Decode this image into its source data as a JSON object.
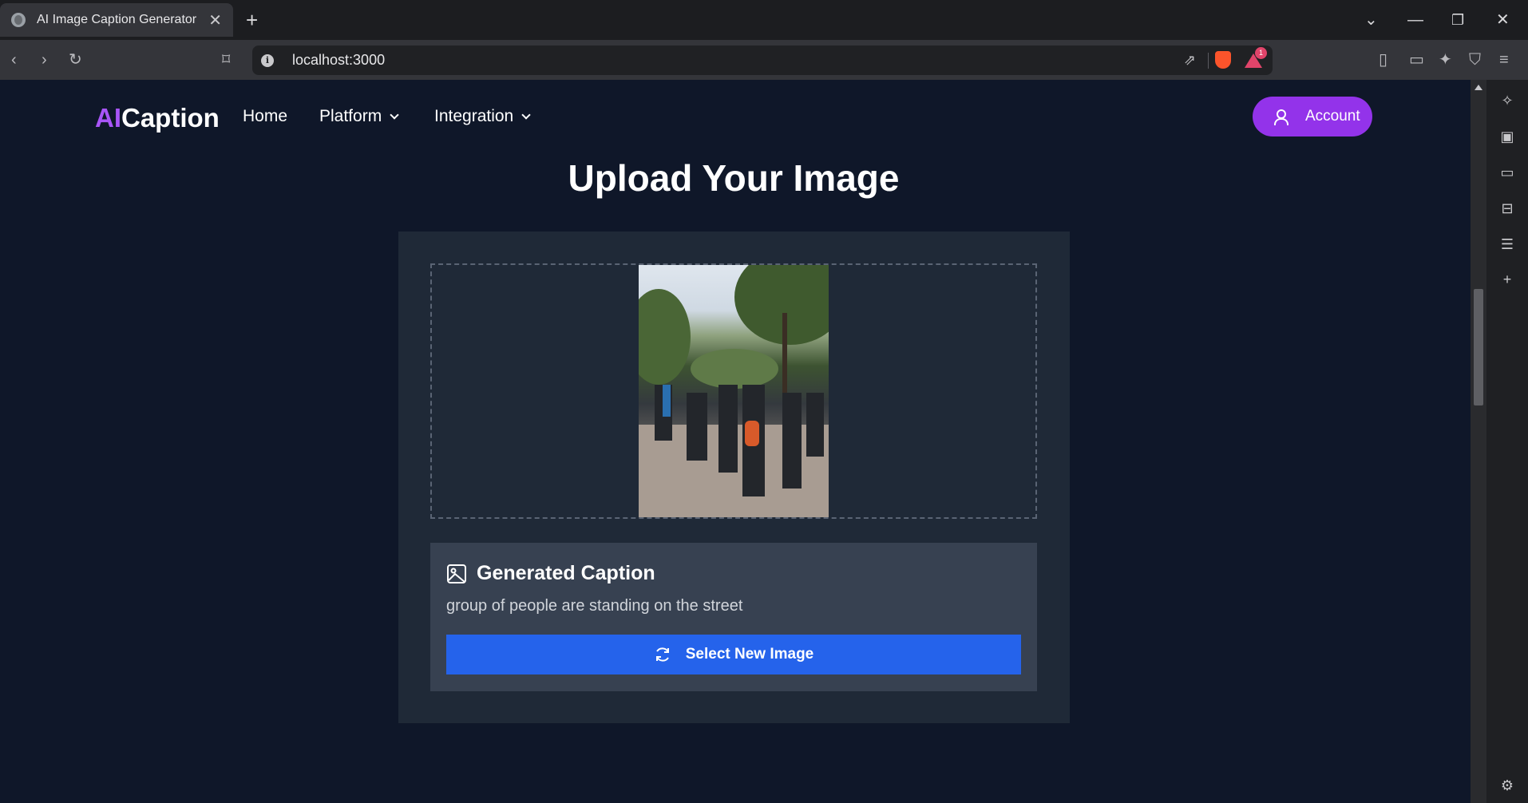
{
  "browser": {
    "tab_title": "AI Image Caption Generator",
    "tab_close": "✕",
    "new_tab": "+",
    "url": "localhost:3000",
    "info_icon": "i",
    "notification_count": "1",
    "window_controls": {
      "dropdown": "⌄",
      "minimize": "—",
      "restore": "❐",
      "close": "✕"
    }
  },
  "site": {
    "logo_prefix": "AI",
    "logo_suffix": "Caption",
    "nav": {
      "home": "Home",
      "platform": "Platform",
      "integration": "Integration"
    },
    "account_label": "Account",
    "accent_color": "#9333ea"
  },
  "main": {
    "title": "Upload Your Image",
    "caption_heading": "Generated Caption",
    "caption_text": "group of people are standing on the street",
    "select_button": "Select New Image",
    "button_color": "#2563eb"
  }
}
